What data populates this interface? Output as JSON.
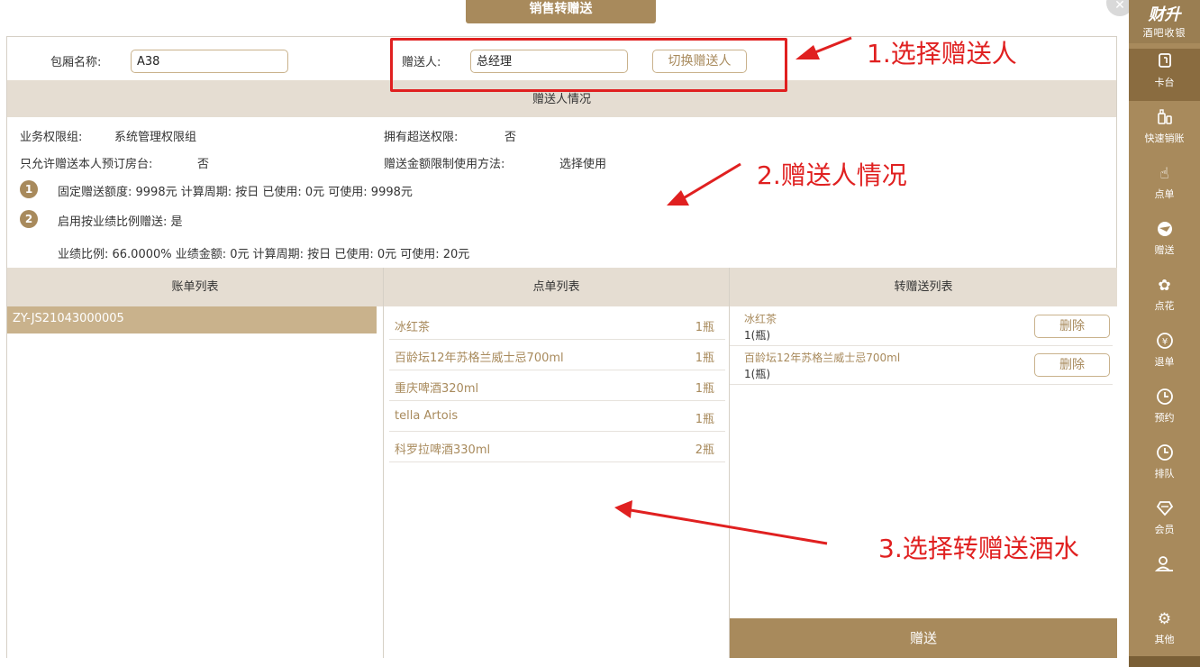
{
  "dialog": {
    "title": "销售转赠送",
    "close_icon": "close-icon"
  },
  "form": {
    "room_label": "包厢名称:",
    "room_value": "A38",
    "giver_label": "赠送人:",
    "giver_value": "总经理",
    "switch_button": "切换赠送人"
  },
  "giver_info": {
    "section_title": "赠送人情况",
    "business_group_label": "业务权限组:",
    "business_group_value": "系统管理权限组",
    "super_gift_label": "拥有超送权限:",
    "super_gift_value": "否",
    "self_booking_label": "只允许赠送本人预订房台:",
    "self_booking_value": "否",
    "limit_method_label": "赠送金额限制使用方法:",
    "limit_method_value": "选择使用",
    "rule1_num": "1",
    "rule1_text": "固定赠送额度: 9998元 计算周期: 按日 已使用: 0元 可使用: 9998元",
    "rule2_num": "2",
    "rule2_text": "启用按业绩比例赠送: 是",
    "rule2_detail": "业绩比例: 66.0000% 业绩金额: 0元 计算周期: 按日 已使用: 0元 可使用: 20元"
  },
  "bill_list": {
    "header": "账单列表",
    "items": [
      "ZY-JS21043000005"
    ]
  },
  "order_list": {
    "header": "点单列表",
    "items": [
      {
        "name": "冰红茶",
        "qty": "1瓶"
      },
      {
        "name": "百龄坛12年苏格兰威士忌700ml",
        "qty": "1瓶"
      },
      {
        "name": "重庆啤酒320ml",
        "qty": "1瓶"
      },
      {
        "name": "tella Artois",
        "qty": "1瓶"
      },
      {
        "name": "科罗拉啤酒330ml",
        "qty": "2瓶"
      }
    ]
  },
  "gift_list": {
    "header": "转赠送列表",
    "items": [
      {
        "name": "冰红茶",
        "qty": "1(瓶)",
        "delete": "删除"
      },
      {
        "name": "百龄坛12年苏格兰威士忌700ml",
        "qty": "1(瓶)",
        "delete": "删除"
      }
    ],
    "give_button": "赠送"
  },
  "annotations": {
    "a1": "1.选择赠送人",
    "a2": "2.赠送人情况",
    "a3": "3.选择转赠送酒水"
  },
  "sidebar": {
    "brand_name": "财升",
    "brand_sub": "酒吧收银",
    "items": [
      {
        "label": "卡台",
        "icon": "table-card-icon"
      },
      {
        "label": "快速销账",
        "icon": "quick-bill-icon"
      },
      {
        "label": "点单",
        "icon": "order-hand-icon"
      },
      {
        "label": "赠送",
        "icon": "gift-icon"
      },
      {
        "label": "点花",
        "icon": "flower-icon"
      },
      {
        "label": "退单",
        "icon": "refund-icon"
      },
      {
        "label": "预约",
        "icon": "clock-icon"
      },
      {
        "label": "排队",
        "icon": "queue-clock-icon"
      },
      {
        "label": "会员",
        "icon": "diamond-icon"
      },
      {
        "label": "",
        "icon": "users-icon"
      },
      {
        "label": "其他",
        "icon": "settings-icon"
      }
    ]
  },
  "colors": {
    "accent": "#a88a5c",
    "section_bg": "#e5ddd2",
    "annotation": "#e02020"
  }
}
